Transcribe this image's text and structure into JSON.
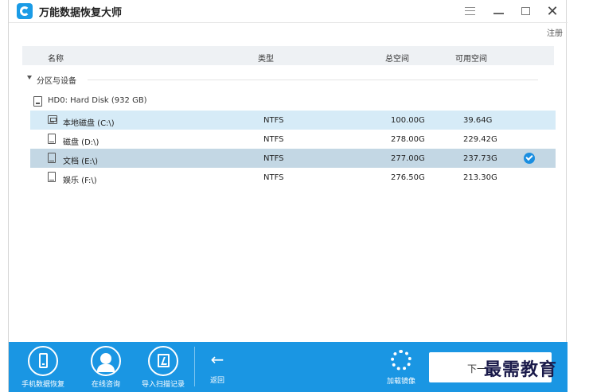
{
  "app": {
    "title": "万能数据恢复大师",
    "register": "注册"
  },
  "colors": {
    "accent": "#1a96e3",
    "row_hover": "#d6ebf7",
    "row_selected": "#c3d7e4"
  },
  "table": {
    "headers": {
      "name": "名称",
      "type": "类型",
      "total": "总空间",
      "free": "可用空间"
    },
    "group": "分区与设备",
    "disk": "HD0: Hard Disk (932 GB)",
    "partitions": [
      {
        "name": "本地磁盘 (C:\\)",
        "type": "NTFS",
        "total": "100.00G",
        "free": "39.64G",
        "icon": "system-drive-icon",
        "state": "hover"
      },
      {
        "name": "磁盘 (D:\\)",
        "type": "NTFS",
        "total": "278.00G",
        "free": "229.42G",
        "icon": "drive-icon",
        "state": "normal"
      },
      {
        "name": "文档 (E:\\)",
        "type": "NTFS",
        "total": "277.00G",
        "free": "237.73G",
        "icon": "drive-icon",
        "state": "selected"
      },
      {
        "name": "娱乐 (F:\\)",
        "type": "NTFS",
        "total": "276.50G",
        "free": "213.30G",
        "icon": "drive-icon",
        "state": "normal"
      }
    ]
  },
  "toolbar": {
    "phone_recovery": "手机数据恢复",
    "online_consult": "在线咨询",
    "import_scan": "导入扫描记录",
    "back": "返回",
    "mount_image": "加载镜像",
    "next": "下一"
  },
  "watermark": "最需教育"
}
